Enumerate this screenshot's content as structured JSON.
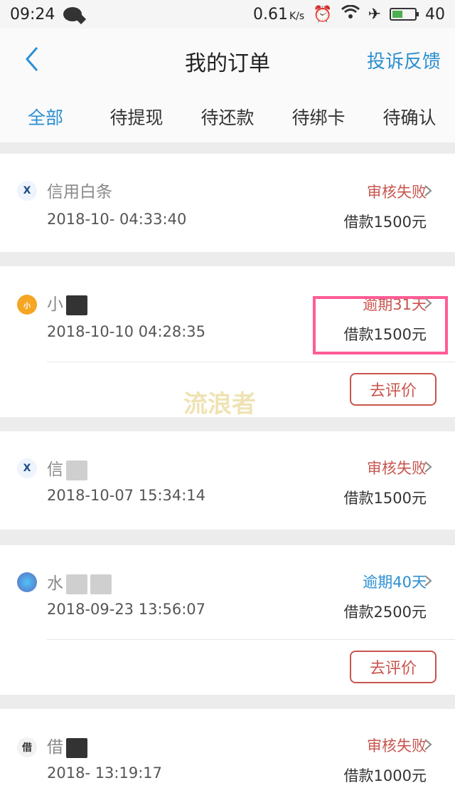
{
  "statusbar": {
    "time": "09:24",
    "speed": "0.61",
    "speed_unit": "K/s",
    "battery": "40"
  },
  "navbar": {
    "title": "我的订单",
    "complaint": "投诉反馈"
  },
  "tabs": [
    "全部",
    "待提现",
    "待还款",
    "待绑卡",
    "待确认"
  ],
  "orders": [
    {
      "name": "信用白条",
      "time": "2018-10-  04:33:40",
      "status": "审核失败",
      "amount": "借款1500元",
      "logo": "X",
      "status_color": "#c7554e"
    },
    {
      "name": "小",
      "time": "2018-10-10 04:28:35",
      "status": "逾期31天",
      "amount": "借款1500元",
      "logo": "小",
      "status_color": "#c7554e",
      "action": "去评价"
    },
    {
      "name": "信",
      "time": "2018-10-07 15:34:14",
      "status": "审核失败",
      "amount": "借款1500元",
      "logo": "X",
      "status_color": "#c7554e"
    },
    {
      "name": "水",
      "time": "2018-09-23 13:56:07",
      "status": "逾期40天",
      "amount": "借款2500元",
      "logo": "",
      "status_color": "#2b8fd2",
      "action": "去评价"
    },
    {
      "name": "借",
      "time": "2018-   13:19:17",
      "status": "审核失败",
      "amount": "借款1000元",
      "logo": "借",
      "status_color": "#c7554e"
    }
  ],
  "watermark": "流浪者"
}
